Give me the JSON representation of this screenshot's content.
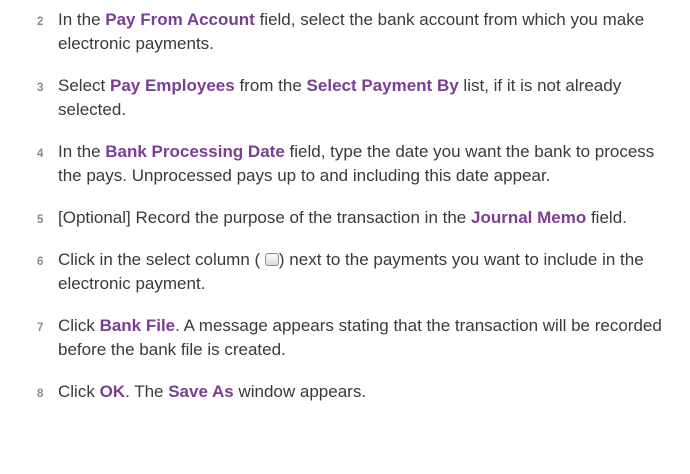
{
  "steps": [
    {
      "num": "2",
      "parts": [
        {
          "t": "In the "
        },
        {
          "t": "Pay From Account",
          "ui": true
        },
        {
          "t": " field, select the bank account from which you make electronic payments."
        }
      ]
    },
    {
      "num": "3",
      "parts": [
        {
          "t": "Select "
        },
        {
          "t": "Pay Employees",
          "ui": true
        },
        {
          "t": " from the "
        },
        {
          "t": "Select Payment By",
          "ui": true
        },
        {
          "t": " list, if it is not already selected."
        }
      ]
    },
    {
      "num": "4",
      "parts": [
        {
          "t": "In the "
        },
        {
          "t": "Bank Processing Date",
          "ui": true
        },
        {
          "t": " field, type the date you want the bank to process the pays. Unprocessed pays up to and including this date appear."
        }
      ]
    },
    {
      "num": "5",
      "parts": [
        {
          "t": "[Optional] Record the purpose of the transaction in the "
        },
        {
          "t": "Journal Memo",
          "ui": true
        },
        {
          "t": " field."
        }
      ]
    },
    {
      "num": "6",
      "parts": [
        {
          "t": "Click in the select column ( "
        },
        {
          "icon": "checkbox-icon"
        },
        {
          "t": ") next to the payments you want to include in the electronic payment."
        }
      ]
    },
    {
      "num": "7",
      "parts": [
        {
          "t": "Click "
        },
        {
          "t": "Bank File",
          "ui": true
        },
        {
          "t": ". A message appears stating that the transaction will be recorded before the bank file is created."
        }
      ]
    },
    {
      "num": "8",
      "parts": [
        {
          "t": "Click "
        },
        {
          "t": "OK",
          "ui": true
        },
        {
          "t": ". The "
        },
        {
          "t": "Save As",
          "ui": true
        },
        {
          "t": " window appears."
        }
      ]
    }
  ]
}
